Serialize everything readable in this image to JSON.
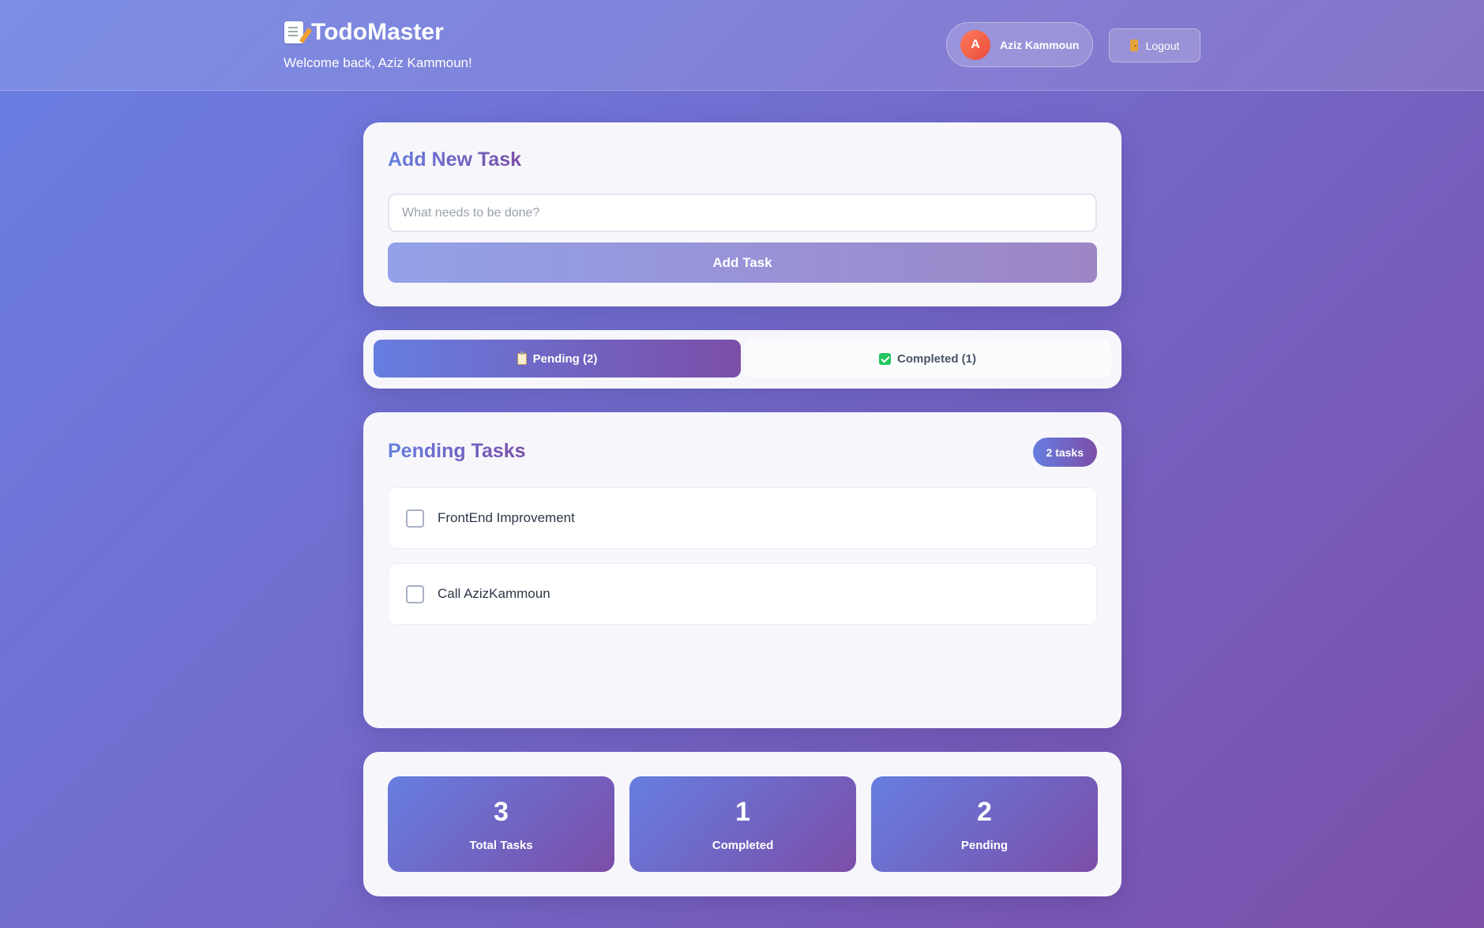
{
  "header": {
    "app_title": "TodoMaster",
    "welcome": "Welcome back, Aziz Kammoun!",
    "user": {
      "initial": "A",
      "name": "Aziz Kammoun"
    },
    "logout_label": "Logout"
  },
  "add_task": {
    "title": "Add New Task",
    "placeholder": "What needs to be done?",
    "value": "",
    "button_label": "Add Task"
  },
  "tabs": [
    {
      "label": "Pending (2)",
      "icon": "clipboard-icon",
      "active": true
    },
    {
      "label": "Completed (1)",
      "icon": "check-box-icon",
      "active": false
    }
  ],
  "pending": {
    "title": "Pending Tasks",
    "badge": "2 tasks",
    "tasks": [
      {
        "text": "FrontEnd Improvement",
        "checked": false
      },
      {
        "text": "Call AzizKammoun",
        "checked": false
      }
    ]
  },
  "stats": [
    {
      "value": "3",
      "label": "Total Tasks"
    },
    {
      "value": "1",
      "label": "Completed"
    },
    {
      "value": "2",
      "label": "Pending"
    }
  ],
  "colors": {
    "accent_start": "#667ee0",
    "accent_end": "#7b4ea8",
    "avatar": "#e94c3d",
    "completed_check": "#22c55e"
  }
}
